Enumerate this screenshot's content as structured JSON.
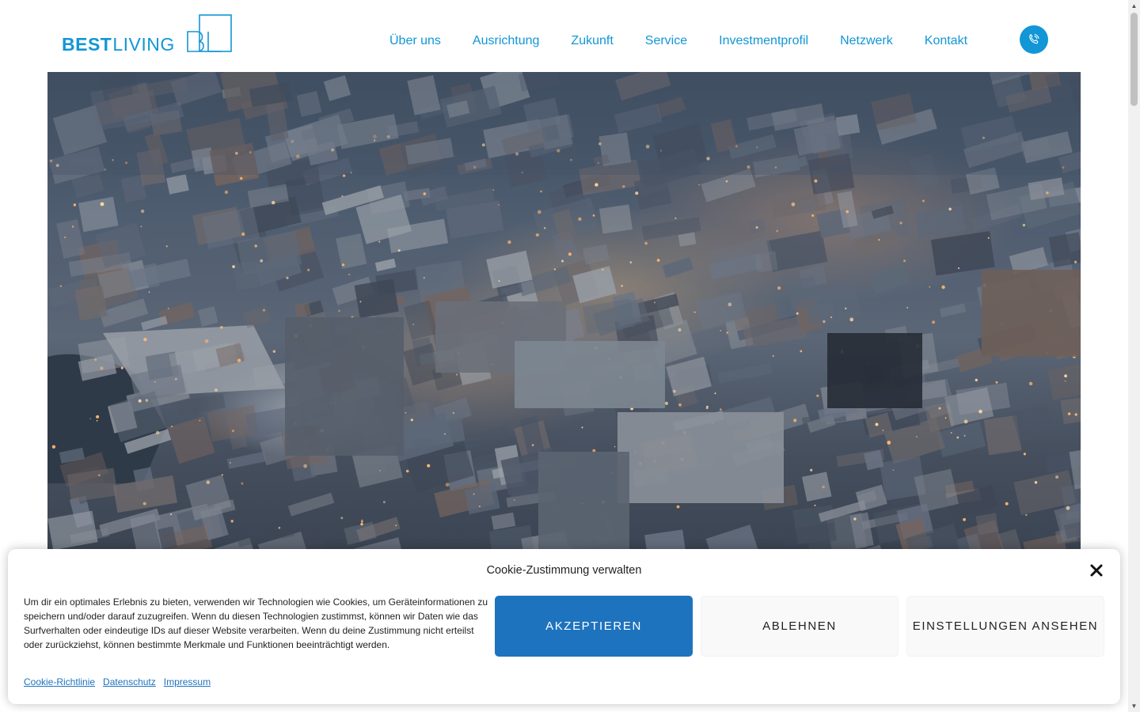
{
  "header": {
    "logo": {
      "part1": "BEST",
      "part2": "LIVING",
      "mark": "BL"
    },
    "nav": [
      {
        "label": "Über uns"
      },
      {
        "label": "Ausrichtung"
      },
      {
        "label": "Zukunft"
      },
      {
        "label": "Service"
      },
      {
        "label": "Investmentprofil"
      },
      {
        "label": "Netzwerk"
      },
      {
        "label": "Kontakt"
      }
    ],
    "phone_icon": "phone-icon"
  },
  "colors": {
    "brand": "#1296d6",
    "accept_button": "#1e73be",
    "secondary_button": "#f9f9f9"
  },
  "cookie": {
    "title": "Cookie-Zustimmung verwalten",
    "text": "Um dir ein optimales Erlebnis zu bieten, verwenden wir Technologien wie Cookies, um Geräteinformationen zu speichern und/oder darauf zuzugreifen. Wenn du diesen Technologien zustimmst, können wir Daten wie das Surfverhalten oder eindeutige IDs auf dieser Website verarbeiten. Wenn du deine Zustimmung nicht erteilst oder zurückziehst, können bestimmte Merkmale und Funktionen beeinträchtigt werden.",
    "accept_label": "AKZEPTIEREN",
    "deny_label": "ABLEHNEN",
    "settings_label": "EINSTELLUNGEN ANSEHEN",
    "links": [
      {
        "label": "Cookie-Richtlinie"
      },
      {
        "label": "Datenschutz"
      },
      {
        "label": "Impressum"
      }
    ]
  }
}
